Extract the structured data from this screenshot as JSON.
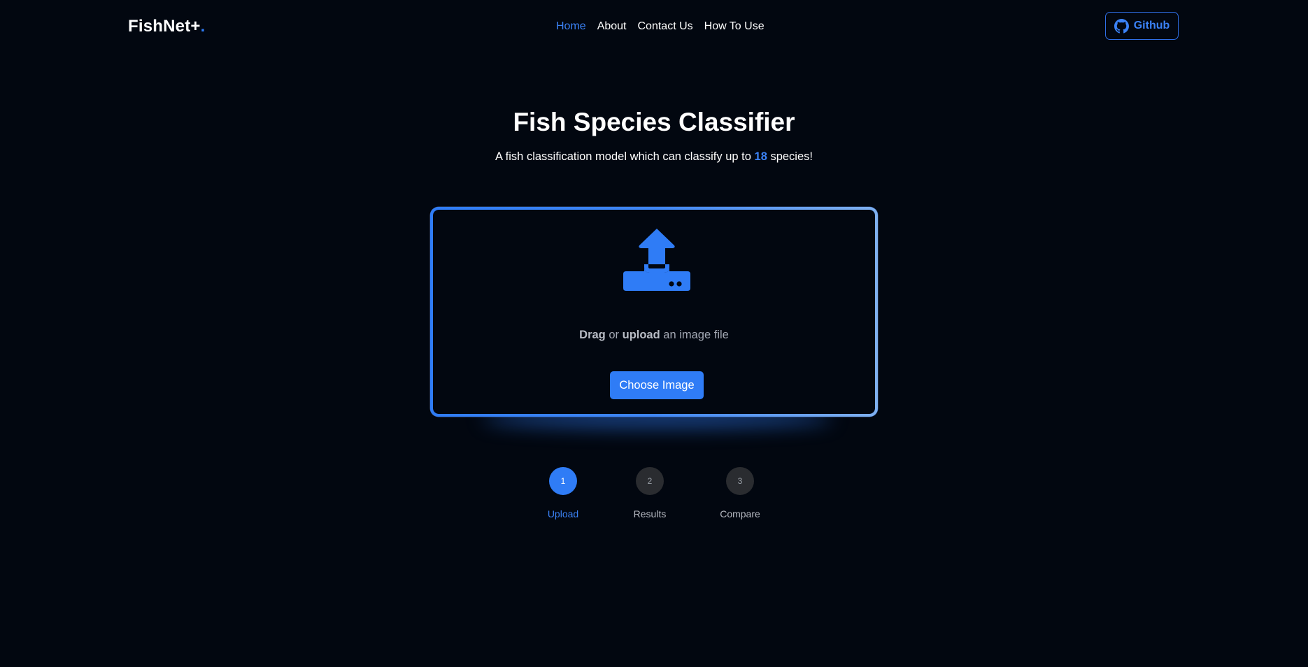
{
  "header": {
    "brand": "FishNet+",
    "brand_dot": ".",
    "nav": [
      {
        "label": "Home",
        "active": true
      },
      {
        "label": "About",
        "active": false
      },
      {
        "label": "Contact Us",
        "active": false
      },
      {
        "label": "How To Use",
        "active": false
      }
    ],
    "github_label": "Github",
    "github_icon": "github-icon"
  },
  "hero": {
    "title": "Fish Species Classifier",
    "subtitle_prefix": "A fish classification model which can classify up to ",
    "subtitle_count": "18",
    "subtitle_suffix": " species!"
  },
  "upload": {
    "icon": "upload-tray-icon",
    "drag_word": "Drag",
    "or_word": " or ",
    "upload_word": "upload",
    "rest_text": " an image file",
    "button_label": "Choose Image"
  },
  "steps": [
    {
      "number": "1",
      "label": "Upload",
      "active": true
    },
    {
      "number": "2",
      "label": "Results",
      "active": false
    },
    {
      "number": "3",
      "label": "Compare",
      "active": false
    }
  ],
  "colors": {
    "background": "#020710",
    "accent": "#2f7cf6",
    "inactive_step": "#2a2c30"
  }
}
